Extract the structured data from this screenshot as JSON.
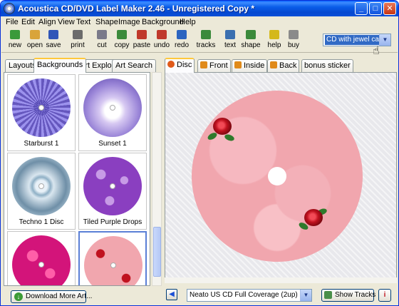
{
  "window": {
    "title": "Acoustica CD/DVD Label Maker 2.46 - Unregistered Copy *",
    "min_glyph": "_",
    "max_glyph": "□",
    "close_glyph": "✕"
  },
  "menu": [
    "File",
    "Edit",
    "Align",
    "View",
    "Text",
    "Shape",
    "Image",
    "Background",
    "Help"
  ],
  "toolbar": {
    "buttons": [
      {
        "label": "new",
        "icon": "new-icon",
        "color": "#3a9a3a"
      },
      {
        "label": "open",
        "icon": "open-folder-icon",
        "color": "#d9a43a"
      },
      {
        "label": "save",
        "icon": "save-disk-icon",
        "color": "#3056b8"
      },
      {
        "label": "print",
        "icon": "printer-icon",
        "color": "#6b6b6b"
      },
      {
        "label": "cut",
        "icon": "scissors-icon",
        "color": "#7a7a8a"
      },
      {
        "label": "copy",
        "icon": "copy-icon",
        "color": "#3b8a3b"
      },
      {
        "label": "paste",
        "icon": "paste-icon",
        "color": "#c0392b"
      },
      {
        "label": "undo",
        "icon": "undo-icon",
        "color": "#c0392b"
      },
      {
        "label": "redo",
        "icon": "redo-icon",
        "color": "#2b64c0"
      },
      {
        "label": "tracks",
        "icon": "tracks-icon",
        "color": "#3b8a3b"
      },
      {
        "label": "text",
        "icon": "text-icon",
        "color": "#3a6fb0"
      },
      {
        "label": "shape",
        "icon": "shape-icon",
        "color": "#3b8a3b"
      },
      {
        "label": "help",
        "icon": "help-icon",
        "color": "#d4b81a"
      },
      {
        "label": "buy",
        "icon": "buy-icon",
        "color": "#8a8a8a"
      }
    ],
    "case_select": "CD with jewel case"
  },
  "left_tabs": [
    "Layouts",
    "Backgrounds",
    "Art Explore",
    "Art Search"
  ],
  "active_left_tab": "Backgrounds",
  "thumbnails": [
    {
      "label": "Starburst 1",
      "style": "starburst"
    },
    {
      "label": "Sunset 1",
      "style": "sunset"
    },
    {
      "label": "Techno 1 Disc",
      "style": "techno"
    },
    {
      "label": "Tiled Purple Drops",
      "style": "purple"
    },
    {
      "label": "",
      "style": "magenta"
    },
    {
      "label": "",
      "style": "roses"
    }
  ],
  "download_button": "Download More Art...",
  "right_tabs": [
    {
      "label": "Disc",
      "icon": "disc-tab-icon",
      "color": "#e05a1a"
    },
    {
      "label": "Front",
      "icon": "front-tab-icon",
      "color": "#e08a1a"
    },
    {
      "label": "Inside",
      "icon": "inside-tab-icon",
      "color": "#e08a1a"
    },
    {
      "label": "Back",
      "icon": "back-tab-icon",
      "color": "#e08a1a"
    },
    {
      "label": "bonus sticker",
      "icon": "",
      "color": ""
    }
  ],
  "active_right_tab": "Disc",
  "layout_select": "Neato US CD Full Coverage (2up)",
  "show_tracks": "Show Tracks",
  "info_glyph": "i"
}
